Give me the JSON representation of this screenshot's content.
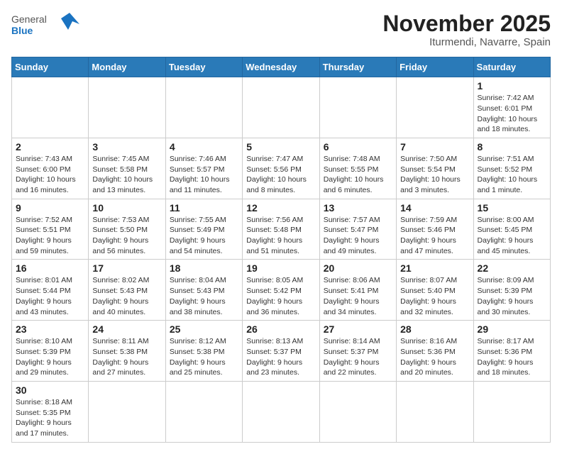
{
  "header": {
    "logo_general": "General",
    "logo_blue": "Blue",
    "month_title": "November 2025",
    "location": "Iturmendi, Navarre, Spain"
  },
  "weekdays": [
    "Sunday",
    "Monday",
    "Tuesday",
    "Wednesday",
    "Thursday",
    "Friday",
    "Saturday"
  ],
  "days": {
    "d1": {
      "num": "1",
      "sunrise": "7:42 AM",
      "sunset": "6:01 PM",
      "daylight": "10 hours and 18 minutes."
    },
    "d2": {
      "num": "2",
      "sunrise": "7:43 AM",
      "sunset": "6:00 PM",
      "daylight": "10 hours and 16 minutes."
    },
    "d3": {
      "num": "3",
      "sunrise": "7:45 AM",
      "sunset": "5:58 PM",
      "daylight": "10 hours and 13 minutes."
    },
    "d4": {
      "num": "4",
      "sunrise": "7:46 AM",
      "sunset": "5:57 PM",
      "daylight": "10 hours and 11 minutes."
    },
    "d5": {
      "num": "5",
      "sunrise": "7:47 AM",
      "sunset": "5:56 PM",
      "daylight": "10 hours and 8 minutes."
    },
    "d6": {
      "num": "6",
      "sunrise": "7:48 AM",
      "sunset": "5:55 PM",
      "daylight": "10 hours and 6 minutes."
    },
    "d7": {
      "num": "7",
      "sunrise": "7:50 AM",
      "sunset": "5:54 PM",
      "daylight": "10 hours and 3 minutes."
    },
    "d8": {
      "num": "8",
      "sunrise": "7:51 AM",
      "sunset": "5:52 PM",
      "daylight": "10 hours and 1 minute."
    },
    "d9": {
      "num": "9",
      "sunrise": "7:52 AM",
      "sunset": "5:51 PM",
      "daylight": "9 hours and 59 minutes."
    },
    "d10": {
      "num": "10",
      "sunrise": "7:53 AM",
      "sunset": "5:50 PM",
      "daylight": "9 hours and 56 minutes."
    },
    "d11": {
      "num": "11",
      "sunrise": "7:55 AM",
      "sunset": "5:49 PM",
      "daylight": "9 hours and 54 minutes."
    },
    "d12": {
      "num": "12",
      "sunrise": "7:56 AM",
      "sunset": "5:48 PM",
      "daylight": "9 hours and 51 minutes."
    },
    "d13": {
      "num": "13",
      "sunrise": "7:57 AM",
      "sunset": "5:47 PM",
      "daylight": "9 hours and 49 minutes."
    },
    "d14": {
      "num": "14",
      "sunrise": "7:59 AM",
      "sunset": "5:46 PM",
      "daylight": "9 hours and 47 minutes."
    },
    "d15": {
      "num": "15",
      "sunrise": "8:00 AM",
      "sunset": "5:45 PM",
      "daylight": "9 hours and 45 minutes."
    },
    "d16": {
      "num": "16",
      "sunrise": "8:01 AM",
      "sunset": "5:44 PM",
      "daylight": "9 hours and 43 minutes."
    },
    "d17": {
      "num": "17",
      "sunrise": "8:02 AM",
      "sunset": "5:43 PM",
      "daylight": "9 hours and 40 minutes."
    },
    "d18": {
      "num": "18",
      "sunrise": "8:04 AM",
      "sunset": "5:43 PM",
      "daylight": "9 hours and 38 minutes."
    },
    "d19": {
      "num": "19",
      "sunrise": "8:05 AM",
      "sunset": "5:42 PM",
      "daylight": "9 hours and 36 minutes."
    },
    "d20": {
      "num": "20",
      "sunrise": "8:06 AM",
      "sunset": "5:41 PM",
      "daylight": "9 hours and 34 minutes."
    },
    "d21": {
      "num": "21",
      "sunrise": "8:07 AM",
      "sunset": "5:40 PM",
      "daylight": "9 hours and 32 minutes."
    },
    "d22": {
      "num": "22",
      "sunrise": "8:09 AM",
      "sunset": "5:39 PM",
      "daylight": "9 hours and 30 minutes."
    },
    "d23": {
      "num": "23",
      "sunrise": "8:10 AM",
      "sunset": "5:39 PM",
      "daylight": "9 hours and 29 minutes."
    },
    "d24": {
      "num": "24",
      "sunrise": "8:11 AM",
      "sunset": "5:38 PM",
      "daylight": "9 hours and 27 minutes."
    },
    "d25": {
      "num": "25",
      "sunrise": "8:12 AM",
      "sunset": "5:38 PM",
      "daylight": "9 hours and 25 minutes."
    },
    "d26": {
      "num": "26",
      "sunrise": "8:13 AM",
      "sunset": "5:37 PM",
      "daylight": "9 hours and 23 minutes."
    },
    "d27": {
      "num": "27",
      "sunrise": "8:14 AM",
      "sunset": "5:37 PM",
      "daylight": "9 hours and 22 minutes."
    },
    "d28": {
      "num": "28",
      "sunrise": "8:16 AM",
      "sunset": "5:36 PM",
      "daylight": "9 hours and 20 minutes."
    },
    "d29": {
      "num": "29",
      "sunrise": "8:17 AM",
      "sunset": "5:36 PM",
      "daylight": "9 hours and 18 minutes."
    },
    "d30": {
      "num": "30",
      "sunrise": "8:18 AM",
      "sunset": "5:35 PM",
      "daylight": "9 hours and 17 minutes."
    }
  }
}
